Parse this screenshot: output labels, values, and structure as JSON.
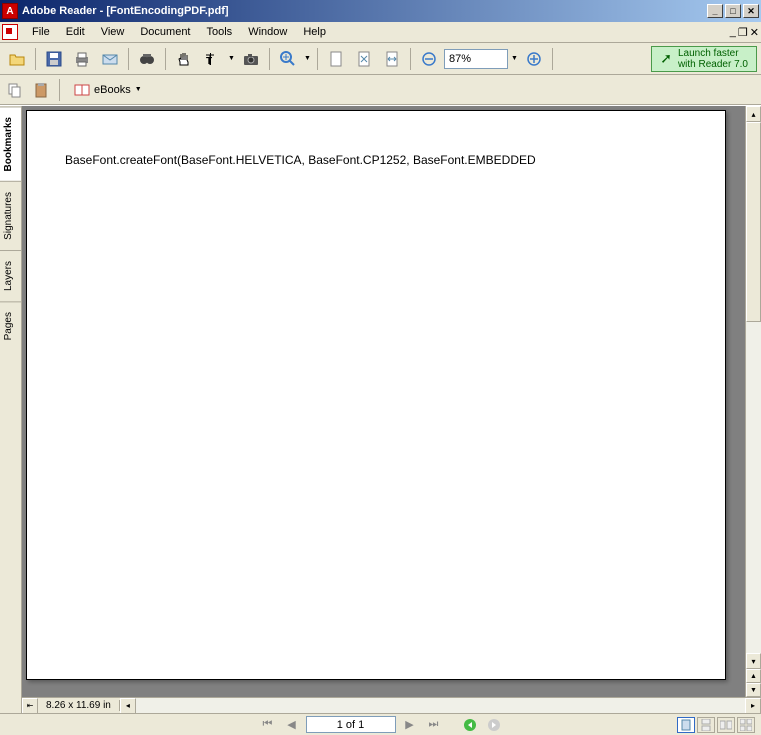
{
  "titlebar": {
    "title": "Adobe Reader - [FontEncodingPDF.pdf]"
  },
  "menu": {
    "items": [
      "File",
      "Edit",
      "View",
      "Document",
      "Tools",
      "Window",
      "Help"
    ]
  },
  "toolbar": {
    "zoom_value": "87%",
    "promo_line1": "Launch faster",
    "promo_line2": "with Reader 7.0"
  },
  "toolbar2": {
    "ebooks_label": "eBooks"
  },
  "sidetabs": {
    "items": [
      "Bookmarks",
      "Signatures",
      "Layers",
      "Pages"
    ]
  },
  "document": {
    "content": "BaseFont.createFont(BaseFont.HELVETICA, BaseFont.CP1252, BaseFont.EMBEDDED"
  },
  "status": {
    "dimensions": "8.26 x 11.69 in"
  },
  "nav": {
    "page_indicator": "1 of 1"
  }
}
